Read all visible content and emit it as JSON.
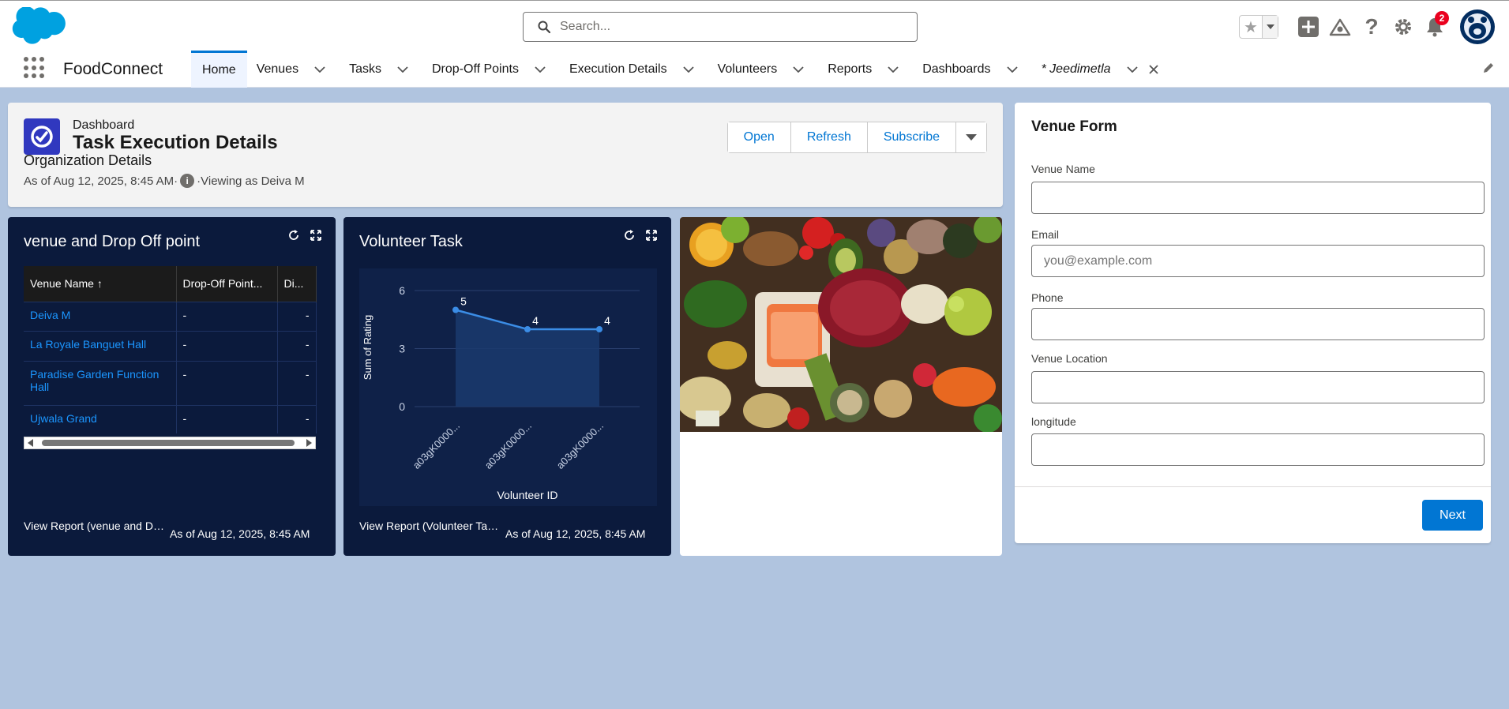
{
  "header": {
    "search_placeholder": "Search...",
    "notification_count": "2",
    "icons": [
      "salesforce-cloud-icon",
      "search-icon",
      "star-icon",
      "chevron-down-icon",
      "add-icon",
      "trailhead-icon",
      "help-icon",
      "gear-icon",
      "bell-icon",
      "avatar-icon"
    ]
  },
  "nav": {
    "app_name": "FoodConnect",
    "items": [
      {
        "label": "Home"
      },
      {
        "label": "Venues"
      },
      {
        "label": "Tasks"
      },
      {
        "label": "Drop-Off Points"
      },
      {
        "label": "Execution Details"
      },
      {
        "label": "Volunteers"
      },
      {
        "label": "Reports"
      },
      {
        "label": "Dashboards"
      },
      {
        "label": "* Jeedimetla"
      }
    ]
  },
  "dashboard": {
    "type_label": "Dashboard",
    "title": "Task Execution Details",
    "subtitle": "Organization Details",
    "as_of": "As of Aug 12, 2025, 8:45 AM",
    "separator": "·",
    "viewing_as": "·Viewing as Deiva M",
    "buttons": {
      "open": "Open",
      "refresh": "Refresh",
      "subscribe": "Subscribe"
    }
  },
  "widget_table": {
    "title": "venue and Drop Off point",
    "columns": [
      "Venue Name ↑",
      "Drop-Off Point...",
      "Di..."
    ],
    "rows": [
      [
        "Deiva M",
        "-",
        "-"
      ],
      [
        "La Royale Banguet Hall",
        "-",
        "-"
      ],
      [
        "Paradise Garden Function Hall",
        "-",
        "-"
      ],
      [
        "Ujwala Grand",
        "-",
        "-"
      ]
    ],
    "footer_link": "View Report (venue and Drop Off point)",
    "footer_time": "As of Aug 12, 2025, 8:45 AM"
  },
  "widget_chart": {
    "title": "Volunteer Task",
    "footer_link": "View Report (Volunteer Task)",
    "footer_time": "As of Aug 12, 2025, 8:45 AM"
  },
  "chart_data": {
    "type": "area",
    "categories": [
      "a03gK0000...",
      "a03gK0000...",
      "a03gK0000..."
    ],
    "series": [
      {
        "values": [
          5,
          4,
          4
        ]
      }
    ],
    "data_labels": [
      "5",
      "4",
      "4"
    ],
    "xlabel": "Volunteer ID",
    "ylabel": "Sum of Rating",
    "yticks": [
      "0",
      "3",
      "6"
    ],
    "ylim": [
      0,
      6
    ],
    "grid": true,
    "colors": {
      "line": "#3b8de6",
      "fill": "#1a3a6e"
    }
  },
  "form": {
    "title": "Venue Form",
    "fields": {
      "venue_name": {
        "label": "Venue Name",
        "value": "",
        "placeholder": ""
      },
      "email": {
        "label": "Email",
        "value": "",
        "placeholder": "you@example.com"
      },
      "phone": {
        "label": "Phone",
        "value": "",
        "placeholder": ""
      },
      "location": {
        "label": "Venue Location",
        "value": "",
        "placeholder": ""
      },
      "longitude": {
        "label": "longitude",
        "value": "",
        "placeholder": ""
      }
    },
    "next_label": "Next"
  },
  "colors": {
    "brand": "#0176d3",
    "dashboard_icon": "#3038bf",
    "widget_bg": "#0b1a3c",
    "page_bg": "#b0c4df"
  }
}
